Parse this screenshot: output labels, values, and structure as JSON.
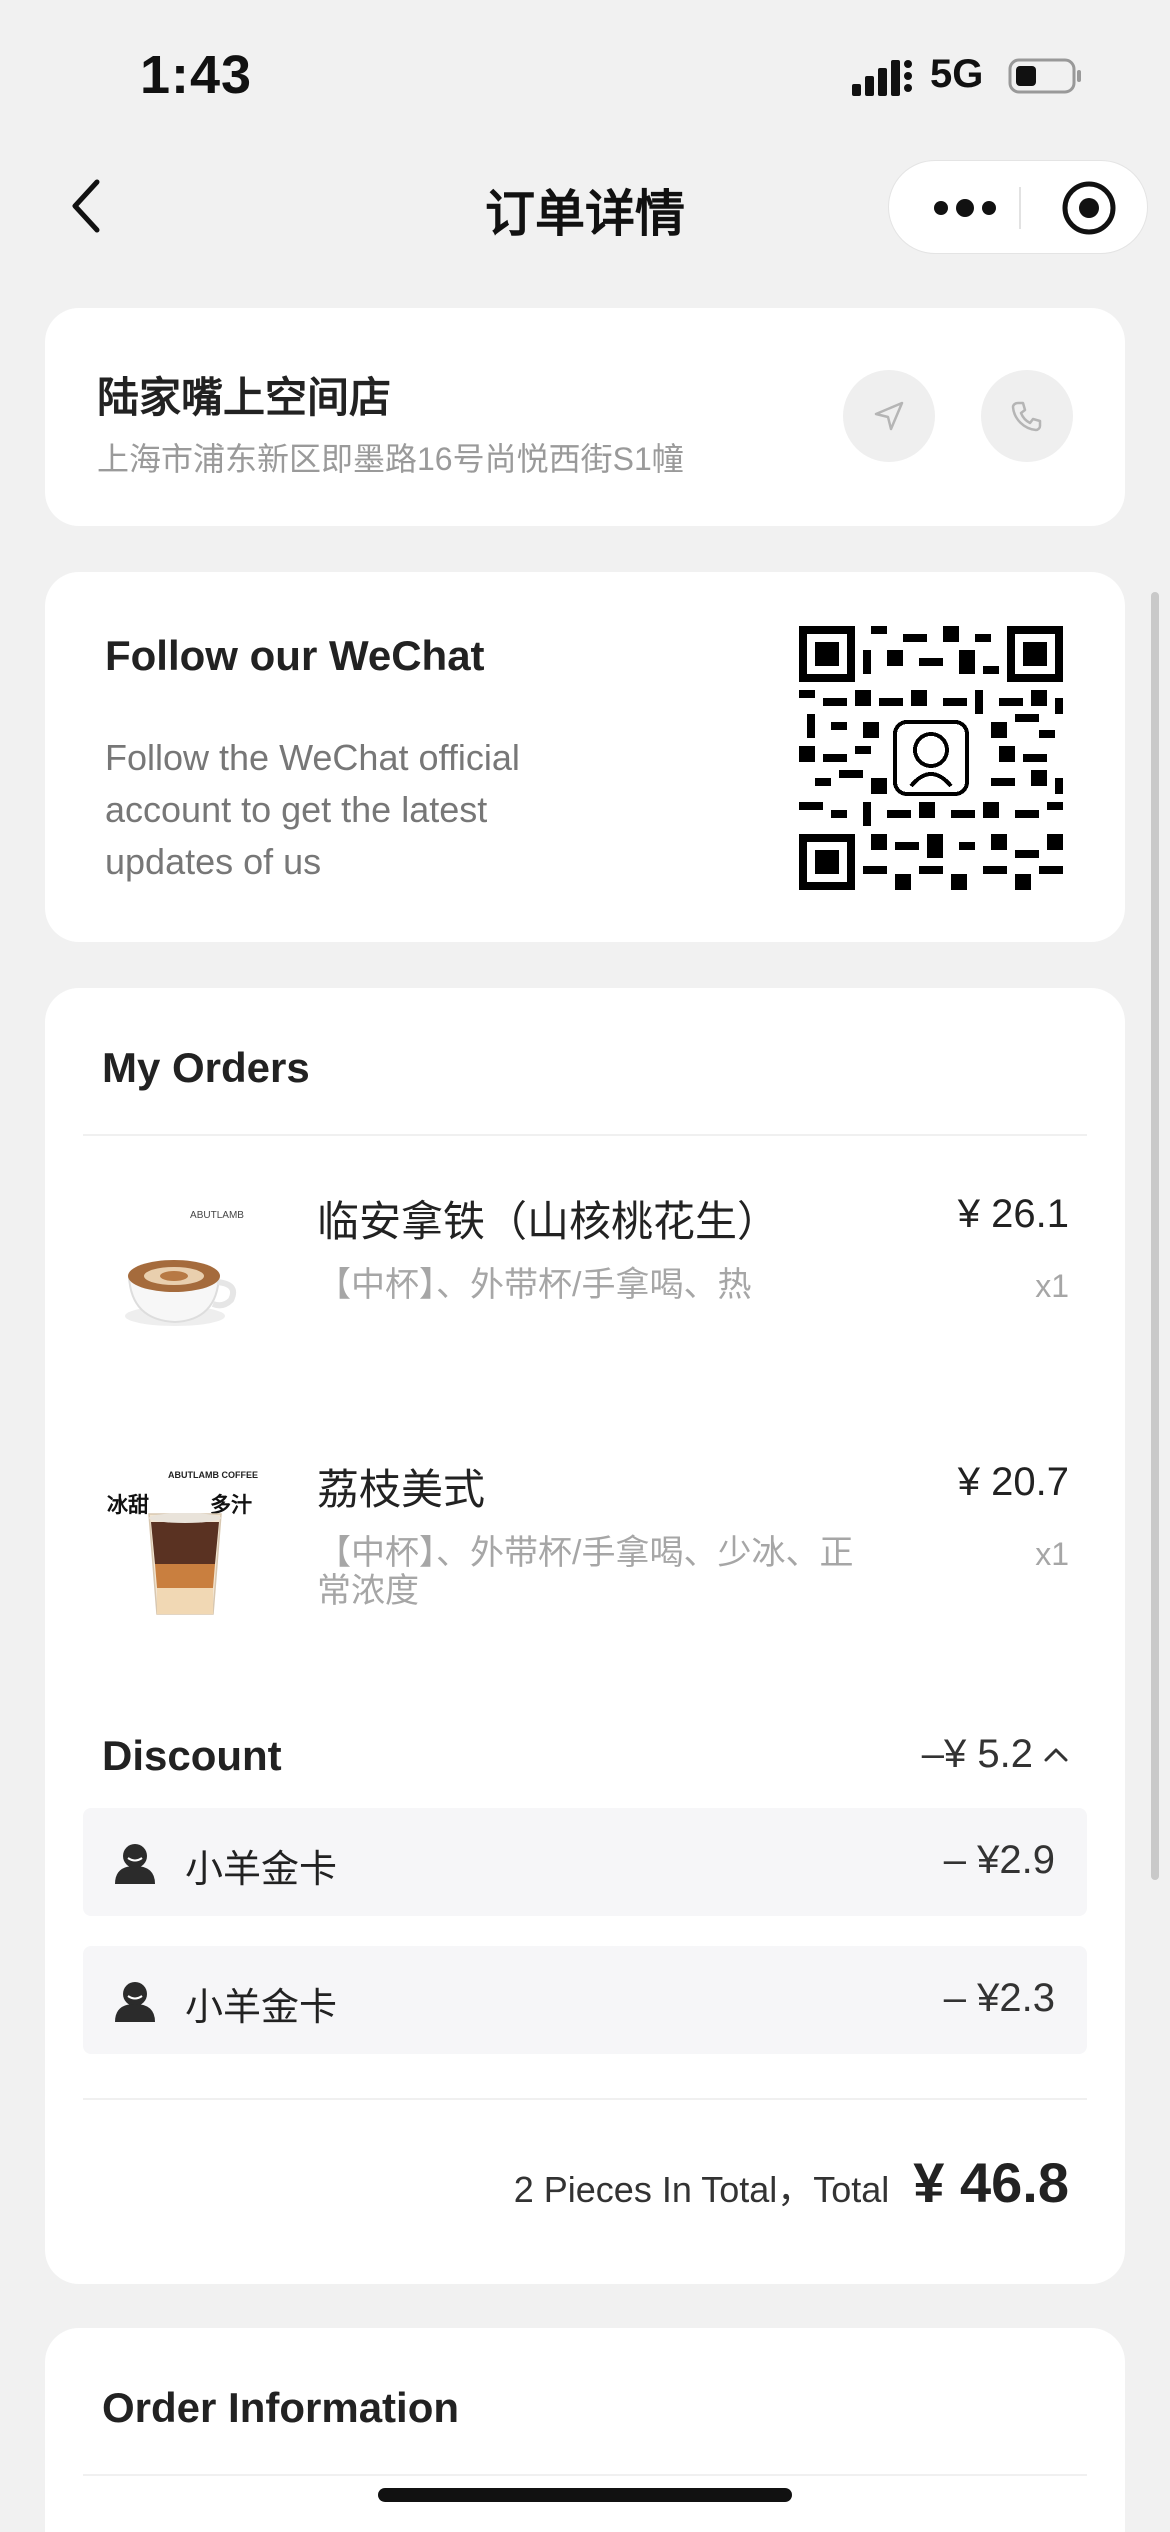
{
  "status_bar": {
    "time": "1:43",
    "network": "5G",
    "signal_icon": "signal-bars-icon",
    "battery_icon": "battery-icon"
  },
  "nav": {
    "title": "订单详情",
    "back_icon": "chevron-left-icon",
    "more_icon": "more-dots-icon",
    "target_icon": "record-target-icon"
  },
  "store": {
    "name": "陆家嘴上空间店",
    "address": "上海市浦东新区即墨路16号尚悦西街S1幢",
    "navigate_icon": "navigation-arrow-icon",
    "phone_icon": "phone-icon"
  },
  "follow": {
    "title": "Follow our WeChat",
    "description": "Follow the WeChat official account to get the latest updates of us",
    "qr_icon": "qr-code-icon"
  },
  "orders": {
    "title": "My Orders",
    "items": [
      {
        "name": "临安拿铁（山核桃花生）",
        "spec": "【中杯】、外带杯/手拿喝、热",
        "price": "¥ 26.1",
        "qty": "x1",
        "image_label": "ABUTLAMB"
      },
      {
        "name": "荔枝美式",
        "spec": "【中杯】、外带杯/手拿喝、少冰、正常浓度",
        "price": "¥ 20.7",
        "qty": "x1",
        "image_label": "ABUTLAMB COFFEE",
        "image_tags": [
          "冰甜",
          "多汁"
        ]
      }
    ],
    "discount": {
      "label": "Discount",
      "total": "–¥ 5.2",
      "rows": [
        {
          "name": "小羊金卡",
          "amount": "– ¥2.9"
        },
        {
          "name": "小羊金卡",
          "amount": "– ¥2.3"
        }
      ]
    },
    "summary_text": "2 Pieces In Total，Total",
    "total_amount": "¥ 46.8"
  },
  "order_info": {
    "title": "Order Information"
  },
  "colors": {
    "background": "#f1f1f1",
    "card": "#ffffff",
    "muted_text": "#9a9a9a"
  }
}
